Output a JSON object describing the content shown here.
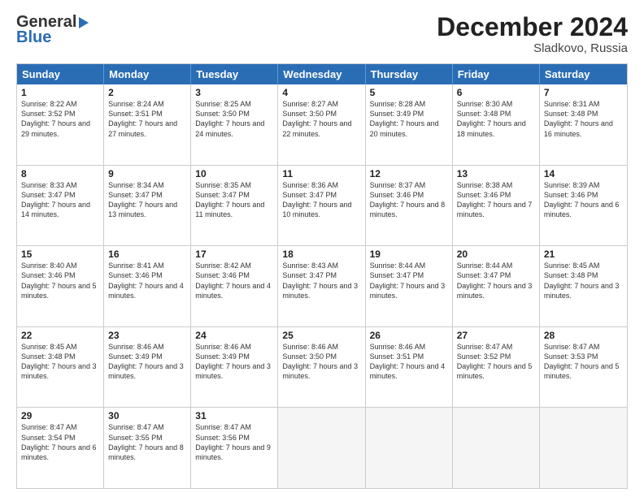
{
  "header": {
    "logo_line1": "General",
    "logo_line2": "Blue",
    "month_title": "December 2024",
    "location": "Sladkovo, Russia"
  },
  "days_of_week": [
    "Sunday",
    "Monday",
    "Tuesday",
    "Wednesday",
    "Thursday",
    "Friday",
    "Saturday"
  ],
  "weeks": [
    [
      {
        "day": "1",
        "sunrise": "Sunrise: 8:22 AM",
        "sunset": "Sunset: 3:52 PM",
        "daylight": "Daylight: 7 hours and 29 minutes."
      },
      {
        "day": "2",
        "sunrise": "Sunrise: 8:24 AM",
        "sunset": "Sunset: 3:51 PM",
        "daylight": "Daylight: 7 hours and 27 minutes."
      },
      {
        "day": "3",
        "sunrise": "Sunrise: 8:25 AM",
        "sunset": "Sunset: 3:50 PM",
        "daylight": "Daylight: 7 hours and 24 minutes."
      },
      {
        "day": "4",
        "sunrise": "Sunrise: 8:27 AM",
        "sunset": "Sunset: 3:50 PM",
        "daylight": "Daylight: 7 hours and 22 minutes."
      },
      {
        "day": "5",
        "sunrise": "Sunrise: 8:28 AM",
        "sunset": "Sunset: 3:49 PM",
        "daylight": "Daylight: 7 hours and 20 minutes."
      },
      {
        "day": "6",
        "sunrise": "Sunrise: 8:30 AM",
        "sunset": "Sunset: 3:48 PM",
        "daylight": "Daylight: 7 hours and 18 minutes."
      },
      {
        "day": "7",
        "sunrise": "Sunrise: 8:31 AM",
        "sunset": "Sunset: 3:48 PM",
        "daylight": "Daylight: 7 hours and 16 minutes."
      }
    ],
    [
      {
        "day": "8",
        "sunrise": "Sunrise: 8:33 AM",
        "sunset": "Sunset: 3:47 PM",
        "daylight": "Daylight: 7 hours and 14 minutes."
      },
      {
        "day": "9",
        "sunrise": "Sunrise: 8:34 AM",
        "sunset": "Sunset: 3:47 PM",
        "daylight": "Daylight: 7 hours and 13 minutes."
      },
      {
        "day": "10",
        "sunrise": "Sunrise: 8:35 AM",
        "sunset": "Sunset: 3:47 PM",
        "daylight": "Daylight: 7 hours and 11 minutes."
      },
      {
        "day": "11",
        "sunrise": "Sunrise: 8:36 AM",
        "sunset": "Sunset: 3:47 PM",
        "daylight": "Daylight: 7 hours and 10 minutes."
      },
      {
        "day": "12",
        "sunrise": "Sunrise: 8:37 AM",
        "sunset": "Sunset: 3:46 PM",
        "daylight": "Daylight: 7 hours and 8 minutes."
      },
      {
        "day": "13",
        "sunrise": "Sunrise: 8:38 AM",
        "sunset": "Sunset: 3:46 PM",
        "daylight": "Daylight: 7 hours and 7 minutes."
      },
      {
        "day": "14",
        "sunrise": "Sunrise: 8:39 AM",
        "sunset": "Sunset: 3:46 PM",
        "daylight": "Daylight: 7 hours and 6 minutes."
      }
    ],
    [
      {
        "day": "15",
        "sunrise": "Sunrise: 8:40 AM",
        "sunset": "Sunset: 3:46 PM",
        "daylight": "Daylight: 7 hours and 5 minutes."
      },
      {
        "day": "16",
        "sunrise": "Sunrise: 8:41 AM",
        "sunset": "Sunset: 3:46 PM",
        "daylight": "Daylight: 7 hours and 4 minutes."
      },
      {
        "day": "17",
        "sunrise": "Sunrise: 8:42 AM",
        "sunset": "Sunset: 3:46 PM",
        "daylight": "Daylight: 7 hours and 4 minutes."
      },
      {
        "day": "18",
        "sunrise": "Sunrise: 8:43 AM",
        "sunset": "Sunset: 3:47 PM",
        "daylight": "Daylight: 7 hours and 3 minutes."
      },
      {
        "day": "19",
        "sunrise": "Sunrise: 8:44 AM",
        "sunset": "Sunset: 3:47 PM",
        "daylight": "Daylight: 7 hours and 3 minutes."
      },
      {
        "day": "20",
        "sunrise": "Sunrise: 8:44 AM",
        "sunset": "Sunset: 3:47 PM",
        "daylight": "Daylight: 7 hours and 3 minutes."
      },
      {
        "day": "21",
        "sunrise": "Sunrise: 8:45 AM",
        "sunset": "Sunset: 3:48 PM",
        "daylight": "Daylight: 7 hours and 3 minutes."
      }
    ],
    [
      {
        "day": "22",
        "sunrise": "Sunrise: 8:45 AM",
        "sunset": "Sunset: 3:48 PM",
        "daylight": "Daylight: 7 hours and 3 minutes."
      },
      {
        "day": "23",
        "sunrise": "Sunrise: 8:46 AM",
        "sunset": "Sunset: 3:49 PM",
        "daylight": "Daylight: 7 hours and 3 minutes."
      },
      {
        "day": "24",
        "sunrise": "Sunrise: 8:46 AM",
        "sunset": "Sunset: 3:49 PM",
        "daylight": "Daylight: 7 hours and 3 minutes."
      },
      {
        "day": "25",
        "sunrise": "Sunrise: 8:46 AM",
        "sunset": "Sunset: 3:50 PM",
        "daylight": "Daylight: 7 hours and 3 minutes."
      },
      {
        "day": "26",
        "sunrise": "Sunrise: 8:46 AM",
        "sunset": "Sunset: 3:51 PM",
        "daylight": "Daylight: 7 hours and 4 minutes."
      },
      {
        "day": "27",
        "sunrise": "Sunrise: 8:47 AM",
        "sunset": "Sunset: 3:52 PM",
        "daylight": "Daylight: 7 hours and 5 minutes."
      },
      {
        "day": "28",
        "sunrise": "Sunrise: 8:47 AM",
        "sunset": "Sunset: 3:53 PM",
        "daylight": "Daylight: 7 hours and 5 minutes."
      }
    ],
    [
      {
        "day": "29",
        "sunrise": "Sunrise: 8:47 AM",
        "sunset": "Sunset: 3:54 PM",
        "daylight": "Daylight: 7 hours and 6 minutes."
      },
      {
        "day": "30",
        "sunrise": "Sunrise: 8:47 AM",
        "sunset": "Sunset: 3:55 PM",
        "daylight": "Daylight: 7 hours and 8 minutes."
      },
      {
        "day": "31",
        "sunrise": "Sunrise: 8:47 AM",
        "sunset": "Sunset: 3:56 PM",
        "daylight": "Daylight: 7 hours and 9 minutes."
      },
      null,
      null,
      null,
      null
    ]
  ]
}
